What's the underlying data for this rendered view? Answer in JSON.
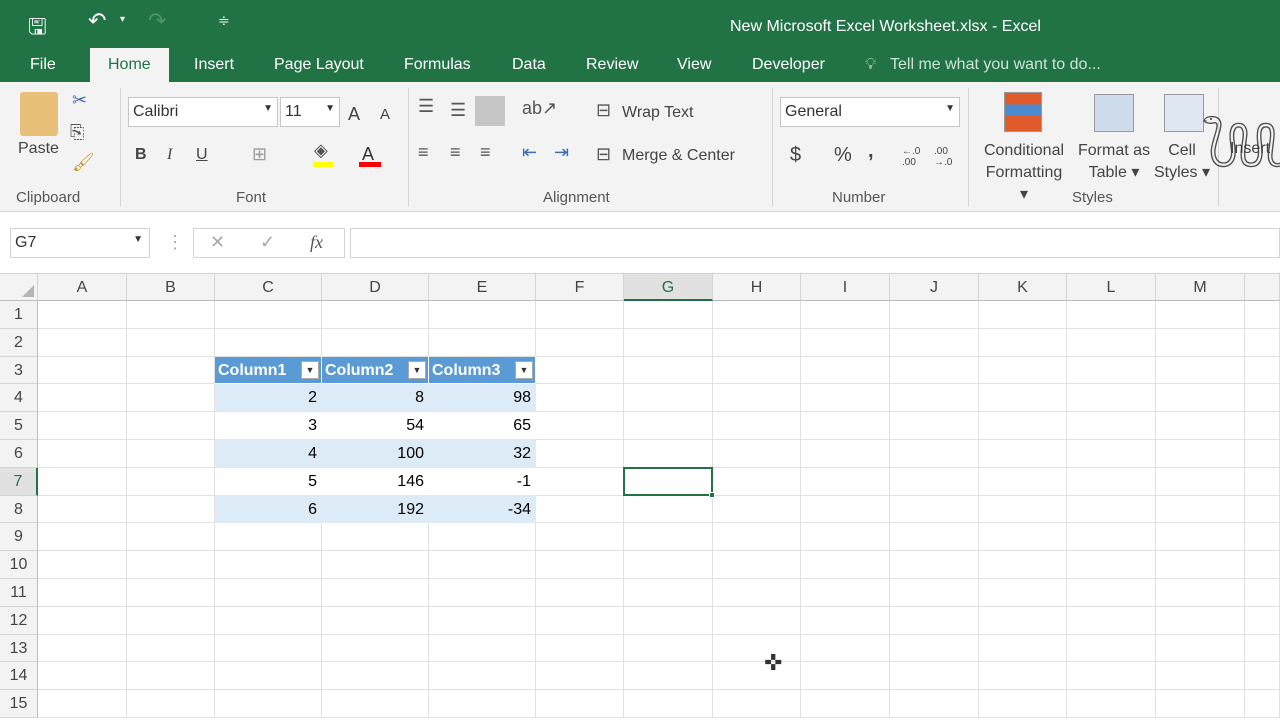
{
  "window": {
    "title": "New Microsoft Excel Worksheet.xlsx - Excel"
  },
  "quick_access": {
    "save": "save-icon",
    "undo": "undo-icon",
    "redo": "redo-icon",
    "customize": "customize-icon"
  },
  "tabs": [
    "File",
    "Home",
    "Insert",
    "Page Layout",
    "Formulas",
    "Data",
    "Review",
    "View",
    "Developer"
  ],
  "active_tab": "Home",
  "tell_me": {
    "placeholder": "Tell me what you want to do..."
  },
  "ribbon": {
    "clipboard": {
      "paste": "Paste",
      "group": "Clipboard"
    },
    "font": {
      "name": "Calibri",
      "size": "11",
      "bold": "B",
      "italic": "I",
      "underline": "U",
      "grow": "A",
      "shrink": "A",
      "color": "A",
      "group": "Font",
      "highlight_color": "#ffff00",
      "font_color": "#ff0000"
    },
    "alignment": {
      "wrap": "Wrap Text",
      "merge": "Merge & Center",
      "group": "Alignment"
    },
    "number": {
      "format": "General",
      "currency": "$",
      "percent": "%",
      "comma": ",",
      "inc": "←.0 .00",
      "dec": ".00 →.0",
      "group": "Number"
    },
    "styles": {
      "conditional": [
        "Conditional",
        "Formatting"
      ],
      "format_table": [
        "Format as",
        "Table"
      ],
      "cell_styles": [
        "Cell",
        "Styles"
      ],
      "group": "Styles"
    },
    "cells": {
      "insert": "Insert"
    }
  },
  "formula_bar": {
    "name_box": "G7",
    "cancel": "✕",
    "enter": "✓",
    "fx": "fx",
    "value": ""
  },
  "columns": [
    "A",
    "B",
    "C",
    "D",
    "E",
    "F",
    "G",
    "H",
    "I",
    "J",
    "K",
    "L",
    "M"
  ],
  "rows": [
    "1",
    "2",
    "3",
    "4",
    "5",
    "6",
    "7",
    "8",
    "9",
    "10",
    "11",
    "12",
    "13",
    "14",
    "15"
  ],
  "selected_cell": "G7",
  "table": {
    "headers": [
      "Column1",
      "Column2",
      "Column3"
    ],
    "rows": [
      [
        "2",
        "8",
        "98"
      ],
      [
        "3",
        "54",
        "65"
      ],
      [
        "4",
        "100",
        "32"
      ],
      [
        "5",
        "146",
        "-1"
      ],
      [
        "6",
        "192",
        "-34"
      ]
    ],
    "header_color": "#5b9bd5",
    "band_color": "#ddebf7"
  },
  "accent": "#217346"
}
